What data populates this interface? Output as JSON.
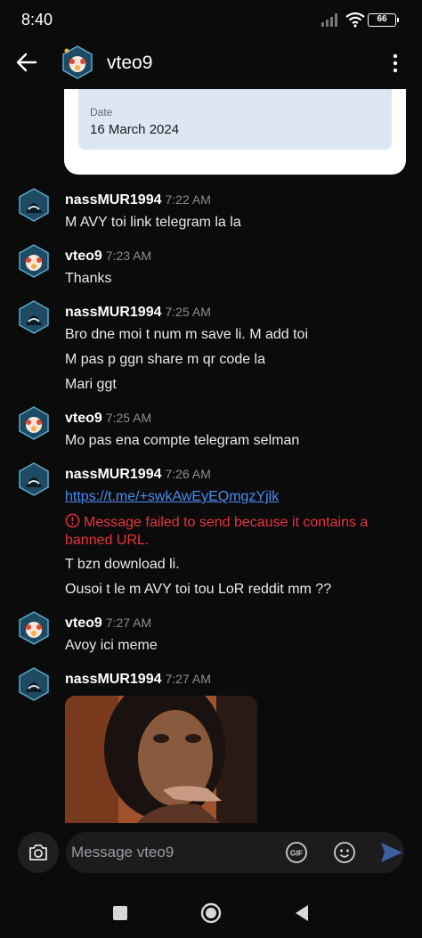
{
  "status_bar": {
    "time": "8:40",
    "battery": "66"
  },
  "header": {
    "title": "vteo9",
    "back_icon": "arrow-left-icon",
    "menu_icon": "kebab-menu-icon"
  },
  "card": {
    "label": "Date",
    "value": "16 March 2024"
  },
  "messages": [
    {
      "user": "nassMUR1994",
      "time": "7:22 AM",
      "lines": [
        "M AVY toi link telegram la la"
      ]
    },
    {
      "user": "vteo9",
      "time": "7:23 AM",
      "lines": [
        "Thanks"
      ]
    },
    {
      "user": "nassMUR1994",
      "time": "7:25 AM",
      "lines": [
        "Bro dne moi t num m save li. M add toi",
        "M pas p ggn share m qr code la",
        "Mari ggt"
      ]
    },
    {
      "user": "vteo9",
      "time": "7:25 AM",
      "lines": [
        "Mo pas ena compte telegram selman"
      ]
    },
    {
      "user": "nassMUR1994",
      "time": "7:26 AM",
      "link": "https://t.me/+swkAwEyEQmgzYjlk",
      "error": "Message failed to send because it contains a banned URL.",
      "lines": [
        "T bzn download li.",
        "Ousoi t le m AVY toi tou LoR reddit mm ??"
      ]
    },
    {
      "user": "vteo9",
      "time": "7:27 AM",
      "lines": [
        "Avoy ici meme"
      ]
    },
    {
      "user": "nassMUR1994",
      "time": "7:27 AM",
      "lines": []
    }
  ],
  "composer": {
    "placeholder": "Message vteo9",
    "camera_icon": "camera-icon",
    "gif_icon": "gif-icon",
    "emoji_icon": "emoji-icon",
    "send_icon": "send-icon"
  },
  "nav_bar": {
    "icons": [
      "recent-apps-icon",
      "home-icon",
      "back-triangle-icon"
    ]
  },
  "colors": {
    "background": "#0b0b0c",
    "link": "#4a8df2",
    "error": "#e5343d",
    "card_inner": "#dde6f3"
  }
}
